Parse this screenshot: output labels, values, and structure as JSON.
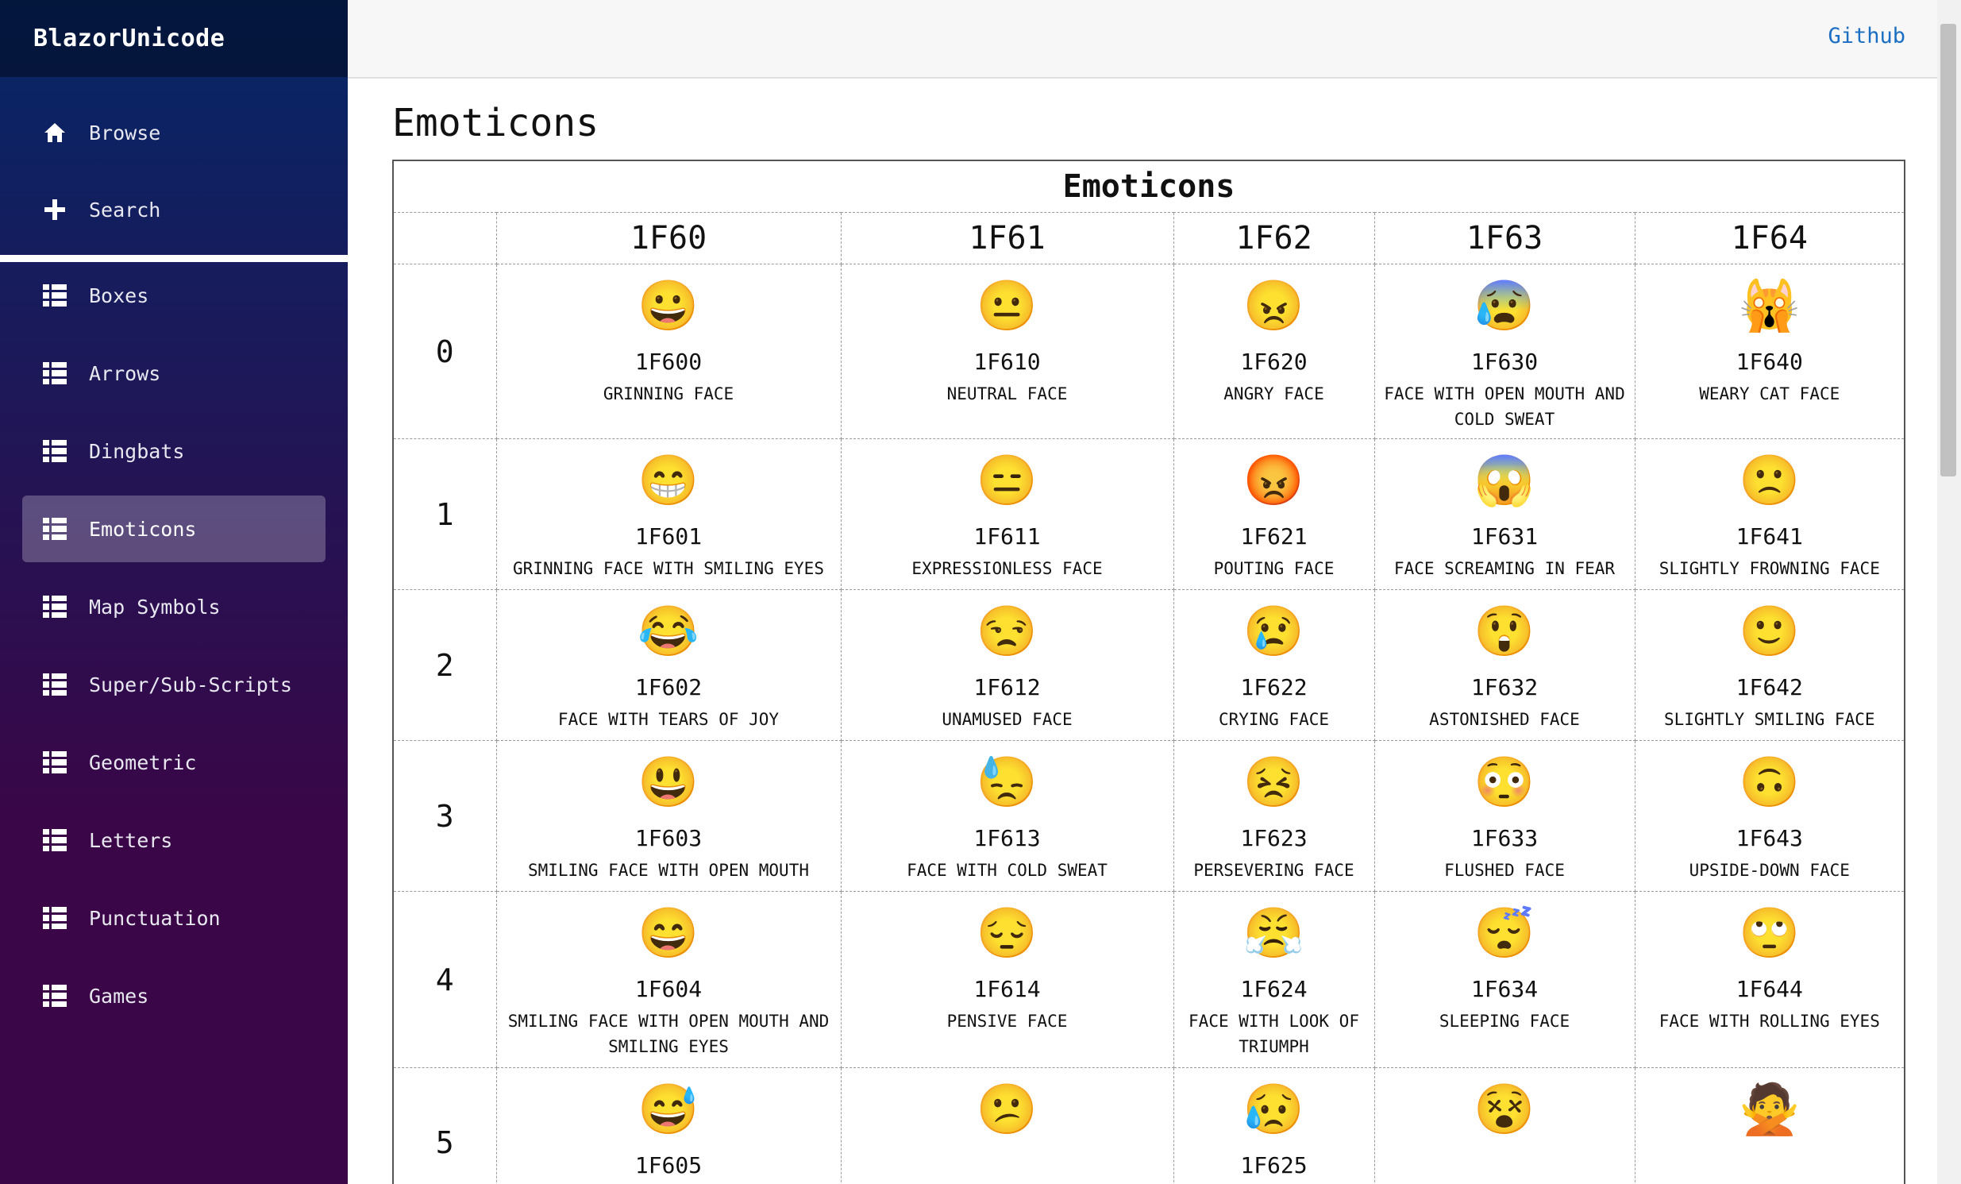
{
  "app": {
    "brand": "BlazorUnicode"
  },
  "nav": {
    "top": [
      {
        "label": "Browse",
        "icon": "home-icon"
      },
      {
        "label": "Search",
        "icon": "plus-icon"
      }
    ],
    "blocks": [
      {
        "label": "Boxes",
        "icon": "list-icon"
      },
      {
        "label": "Arrows",
        "icon": "list-icon"
      },
      {
        "label": "Dingbats",
        "icon": "list-icon"
      },
      {
        "label": "Emoticons",
        "icon": "list-icon",
        "active": true
      },
      {
        "label": "Map Symbols",
        "icon": "list-icon"
      },
      {
        "label": "Super/Sub-Scripts",
        "icon": "list-icon"
      },
      {
        "label": "Geometric",
        "icon": "list-icon"
      },
      {
        "label": "Letters",
        "icon": "list-icon"
      },
      {
        "label": "Punctuation",
        "icon": "list-icon"
      },
      {
        "label": "Games",
        "icon": "list-icon"
      }
    ]
  },
  "topbar": {
    "github_label": "Github"
  },
  "page": {
    "title": "Emoticons"
  },
  "table": {
    "caption": "Emoticons",
    "columns": [
      "1F60",
      "1F61",
      "1F62",
      "1F63",
      "1F64"
    ],
    "rows": [
      {
        "label": "0",
        "cells": [
          {
            "glyph": "😀",
            "code": "1F600",
            "name": "GRINNING FACE"
          },
          {
            "glyph": "😐",
            "code": "1F610",
            "name": "NEUTRAL FACE"
          },
          {
            "glyph": "😠",
            "code": "1F620",
            "name": "ANGRY FACE"
          },
          {
            "glyph": "😰",
            "code": "1F630",
            "name": "FACE WITH OPEN MOUTH AND COLD SWEAT"
          },
          {
            "glyph": "🙀",
            "code": "1F640",
            "name": "WEARY CAT FACE"
          }
        ]
      },
      {
        "label": "1",
        "cells": [
          {
            "glyph": "😁",
            "code": "1F601",
            "name": "GRINNING FACE WITH SMILING EYES"
          },
          {
            "glyph": "😑",
            "code": "1F611",
            "name": "EXPRESSIONLESS FACE"
          },
          {
            "glyph": "😡",
            "code": "1F621",
            "name": "POUTING FACE"
          },
          {
            "glyph": "😱",
            "code": "1F631",
            "name": "FACE SCREAMING IN FEAR"
          },
          {
            "glyph": "🙁",
            "code": "1F641",
            "name": "SLIGHTLY FROWNING FACE"
          }
        ]
      },
      {
        "label": "2",
        "cells": [
          {
            "glyph": "😂",
            "code": "1F602",
            "name": "FACE WITH TEARS OF JOY"
          },
          {
            "glyph": "😒",
            "code": "1F612",
            "name": "UNAMUSED FACE"
          },
          {
            "glyph": "😢",
            "code": "1F622",
            "name": "CRYING FACE"
          },
          {
            "glyph": "😲",
            "code": "1F632",
            "name": "ASTONISHED FACE"
          },
          {
            "glyph": "🙂",
            "code": "1F642",
            "name": "SLIGHTLY SMILING FACE"
          }
        ]
      },
      {
        "label": "3",
        "cells": [
          {
            "glyph": "😃",
            "code": "1F603",
            "name": "SMILING FACE WITH OPEN MOUTH"
          },
          {
            "glyph": "😓",
            "code": "1F613",
            "name": "FACE WITH COLD SWEAT"
          },
          {
            "glyph": "😣",
            "code": "1F623",
            "name": "PERSEVERING FACE"
          },
          {
            "glyph": "😳",
            "code": "1F633",
            "name": "FLUSHED FACE"
          },
          {
            "glyph": "🙃",
            "code": "1F643",
            "name": "UPSIDE-DOWN FACE"
          }
        ]
      },
      {
        "label": "4",
        "cells": [
          {
            "glyph": "😄",
            "code": "1F604",
            "name": "SMILING FACE WITH OPEN MOUTH AND SMILING EYES"
          },
          {
            "glyph": "😔",
            "code": "1F614",
            "name": "PENSIVE FACE"
          },
          {
            "glyph": "😤",
            "code": "1F624",
            "name": "FACE WITH LOOK OF TRIUMPH"
          },
          {
            "glyph": "😴",
            "code": "1F634",
            "name": "SLEEPING FACE"
          },
          {
            "glyph": "🙄",
            "code": "1F644",
            "name": "FACE WITH ROLLING EYES"
          }
        ]
      },
      {
        "label": "5",
        "cells": [
          {
            "glyph": "😅",
            "code": "1F605",
            "name": ""
          },
          {
            "glyph": "😕",
            "code": "",
            "name": ""
          },
          {
            "glyph": "😥",
            "code": "1F625",
            "name": ""
          },
          {
            "glyph": "😵",
            "code": "",
            "name": ""
          },
          {
            "glyph": "🙅",
            "code": "",
            "name": ""
          }
        ]
      }
    ]
  }
}
